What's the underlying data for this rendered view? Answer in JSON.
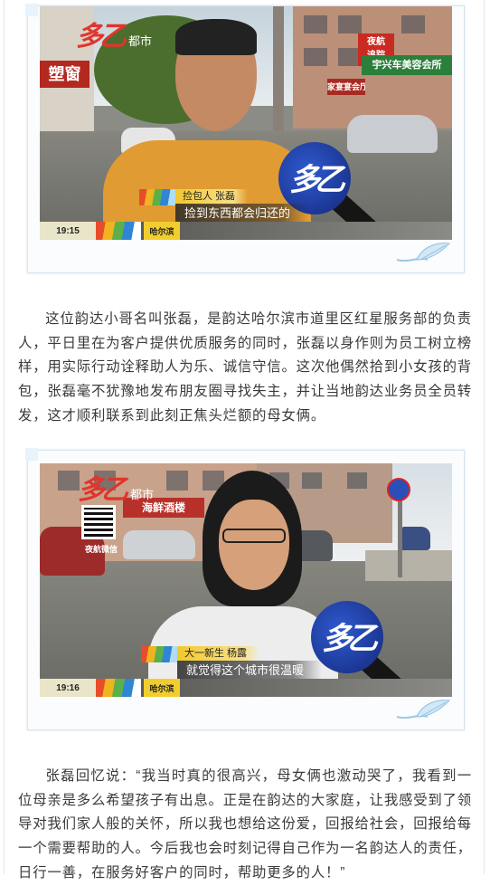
{
  "photo1": {
    "logo_sub": "都市",
    "shop_sign": "塑窗",
    "night_tag_line1": "夜航",
    "night_tag_line2": "追踪",
    "street_sign": "宇兴车美容会所",
    "shop_sign2": "家宴宴会厅",
    "caption_name": "捡包人 张磊",
    "caption_quote": "捡到东西都会归还的",
    "time": "19:15",
    "location": "哈尔滨"
  },
  "paragraph1": "这位韵达小哥名叫张磊，是韵达哈尔滨市道里区红星服务部的负责人，平日里在为客户提供优质服务的同时，张磊以身作则为员工树立榜样，用实际行动诠释助人为乐、诚信守信。这次他偶然拾到小女孩的背包，张磊毫不犹豫地发布朋友圈寻找失主，并让当地韵达业务员全员转发，这才顺利联系到此刻正焦头烂额的母女俩。",
  "photo2": {
    "logo_sub": "都市",
    "logo_sub2": "夜航",
    "qr_label": "夜航微信",
    "shop_sign": "海鲜酒楼",
    "caption_name": "大一新生 杨露",
    "caption_quote": "就觉得这个城市很温暖",
    "time": "19:16",
    "location": "哈尔滨"
  },
  "paragraph2": "张磊回忆说：“我当时真的很高兴，母女俩也激动哭了，我看到一位母亲是多么希望孩子有出息。正是在韵达的大家庭，让我感受到了领导对我们家人般的关怀，所以我也想给这份爱，回报给社会，回报给每一个需要帮助的人。今后我也会时刻记得自己作为一名韵达人的责任，日行一善，在服务好客户的同时，帮助更多的人！”",
  "colors": {
    "text": "#3a3a3a",
    "card_border": "#d8e4ee",
    "caption_yellow": "#f2c82e",
    "mic_blue": "#1f3ea8",
    "logo_red": "#e0352b"
  }
}
